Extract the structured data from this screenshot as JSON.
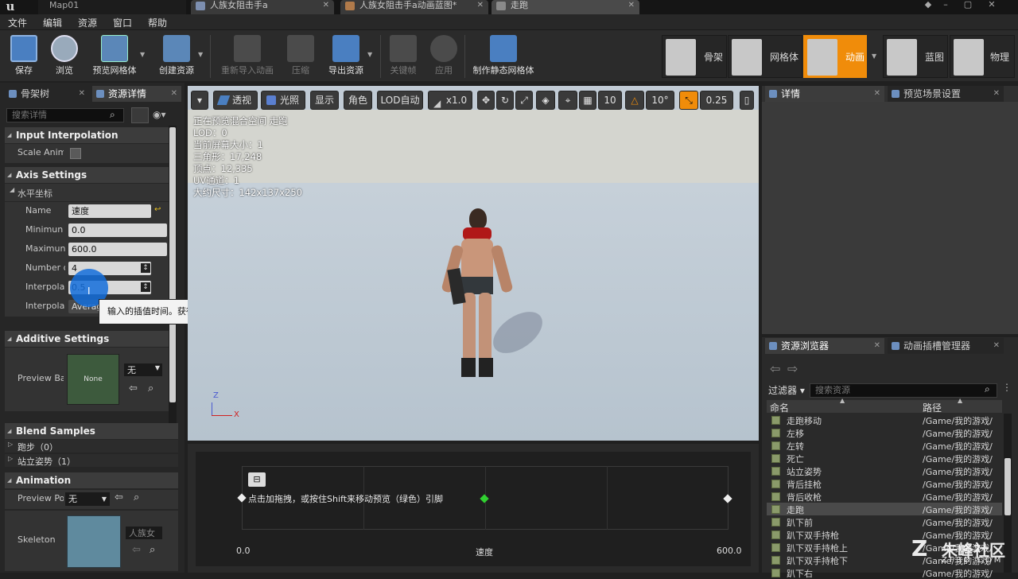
{
  "titlebar": {
    "map_tab": "Map01",
    "doc_tabs": [
      "人族女阻击手a",
      "人族女阻击手a动画蓝图*",
      "走跑"
    ]
  },
  "menu": [
    "文件",
    "编辑",
    "资源",
    "窗口",
    "帮助"
  ],
  "toolbar": [
    {
      "label": "保存",
      "icon": "save-icon",
      "enabled": true
    },
    {
      "label": "浏览",
      "icon": "browse-icon",
      "enabled": true
    },
    {
      "label": "预览网格体",
      "icon": "preview-mesh-icon",
      "enabled": true
    },
    {
      "label": "创建资源",
      "icon": "create-asset-icon",
      "enabled": true
    },
    {
      "label": "重新导入动画",
      "icon": "reimport-icon",
      "enabled": false
    },
    {
      "label": "压缩",
      "icon": "compress-icon",
      "enabled": false
    },
    {
      "label": "导出资源",
      "icon": "export-icon",
      "enabled": true
    },
    {
      "label": "关键帧",
      "icon": "keyframe-icon",
      "enabled": false
    },
    {
      "label": "应用",
      "icon": "apply-icon",
      "enabled": false
    },
    {
      "label": "制作静态网格体",
      "icon": "static-mesh-icon",
      "enabled": true
    }
  ],
  "modes": [
    {
      "label": "骨架",
      "active": false
    },
    {
      "label": "网格体",
      "active": false
    },
    {
      "label": "动画",
      "active": true
    },
    {
      "label": "蓝图",
      "active": false
    },
    {
      "label": "物理",
      "active": false
    }
  ],
  "left_panel": {
    "tabs": [
      "骨架树",
      "资源详情"
    ],
    "search_placeholder": "搜索详情",
    "sections": {
      "input_interpolation": "Input Interpolation",
      "scale_anim": "Scale Anim",
      "axis_settings": "Axis Settings",
      "horizontal_axis": "水平坐标",
      "additive_settings": "Additive Settings",
      "blend_samples": "Blend Samples",
      "animation": "Animation"
    },
    "axis": {
      "name_label": "Name",
      "name_value": "速度",
      "min_label": "Minimun",
      "min_value": "0.0",
      "max_label": "Maximun",
      "max_value": "600.0",
      "num_label": "Number o",
      "num_value": "4",
      "interp_time_label": "Interpola",
      "interp_time_value": "0.5",
      "interp_type_label": "Interpola",
      "interp_type_value": "Averag"
    },
    "additive": {
      "preview_label": "Preview Ba",
      "thumb_text": "None",
      "combo": "无"
    },
    "blend_samples": [
      "跑步（0）",
      "站立姿势（1）"
    ],
    "animation": {
      "preview_pose_label": "Preview Po",
      "preview_pose_value": "无",
      "skeleton_label": "Skeleton",
      "skeleton_value": "人族女"
    }
  },
  "tooltip": "输入的插值时间。获得输出时，其将使用此事件来插值到对象，用于更平滑的插值。",
  "viewport": {
    "buttons": [
      "透视",
      "光照",
      "显示",
      "角色",
      "LOD自动",
      "x1.0",
      "10",
      "10°",
      "0.25"
    ],
    "info": [
      "正在预览混合空间 走跑",
      "LOD：0",
      "当前屏幕大小：1",
      "三角形：17,248",
      "顶点：12,335",
      "UV通道：1",
      "大约尺寸：142x137x250"
    ],
    "axis_z": "Z",
    "axis_x": "X"
  },
  "blendspace": {
    "hint": "点击加拖拽，或按住Shift来移动预览（绿色）引脚",
    "min_label": "0.0",
    "axis_label": "速度",
    "max_label": "600.0"
  },
  "right_top": {
    "tabs": [
      "详情",
      "预览场景设置"
    ]
  },
  "content_browser": {
    "tabs": [
      "资源浏览器",
      "动画插槽管理器"
    ],
    "filter_label": "过滤器",
    "search_placeholder": "搜索资源",
    "col_name": "命名",
    "col_path": "路径",
    "rows": [
      {
        "name": "走跑移动",
        "path": "/Game/我的游戏/",
        "selected": false
      },
      {
        "name": "左移",
        "path": "/Game/我的游戏/",
        "selected": false
      },
      {
        "name": "左转",
        "path": "/Game/我的游戏/",
        "selected": false
      },
      {
        "name": "死亡",
        "path": "/Game/我的游戏/",
        "selected": false
      },
      {
        "name": "站立姿势",
        "path": "/Game/我的游戏/",
        "selected": false
      },
      {
        "name": "背后挂枪",
        "path": "/Game/我的游戏/",
        "selected": false
      },
      {
        "name": "背后收枪",
        "path": "/Game/我的游戏/",
        "selected": false
      },
      {
        "name": "走跑",
        "path": "/Game/我的游戏/",
        "selected": true
      },
      {
        "name": "趴下前",
        "path": "/Game/我的游戏/",
        "selected": false
      },
      {
        "name": "趴下双手持枪",
        "path": "/Game/我的游戏/",
        "selected": false
      },
      {
        "name": "趴下双手持枪上",
        "path": "/Game/我的游戏/",
        "selected": false
      },
      {
        "name": "趴下双手持枪下",
        "path": "/Game/我的游戏/",
        "selected": false
      },
      {
        "name": "趴下右",
        "path": "/Game/我的游戏/",
        "selected": false
      }
    ]
  },
  "watermark": {
    "main": "朱峰社区",
    "sub": "ZF3D.COM"
  }
}
